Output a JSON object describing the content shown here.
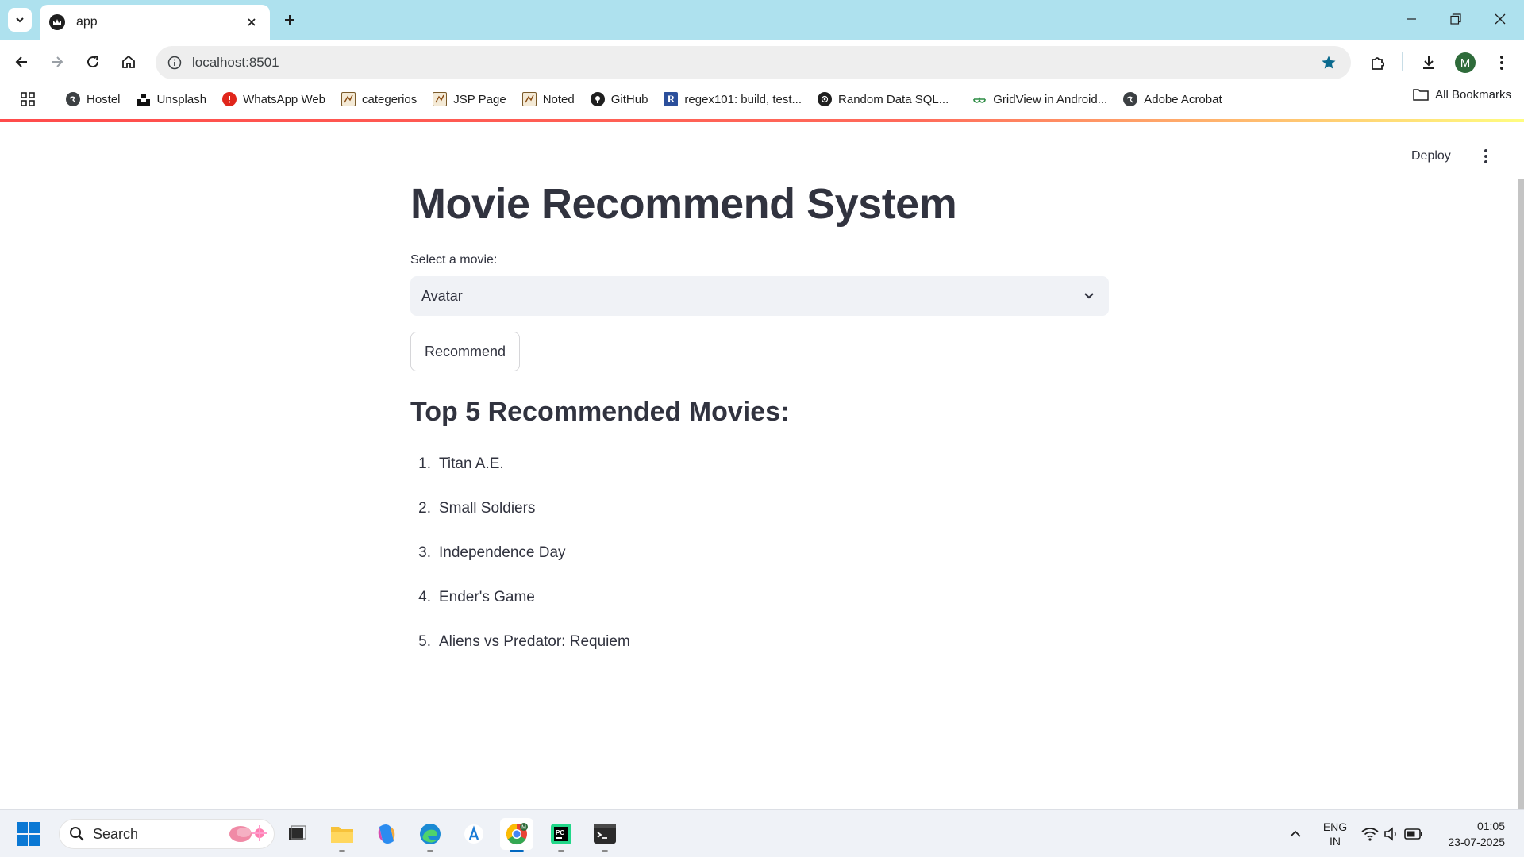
{
  "browser": {
    "tab_title": "app",
    "url": "localhost:8501",
    "profile_initial": "M"
  },
  "bookmarks": [
    {
      "label": "Hostel",
      "icon": "globe-icon"
    },
    {
      "label": "Unsplash",
      "icon": "unsplash-icon"
    },
    {
      "label": "WhatsApp Web",
      "icon": "alert-icon"
    },
    {
      "label": "categerios",
      "icon": "jsp-page-icon"
    },
    {
      "label": "JSP Page",
      "icon": "jsp-page-icon"
    },
    {
      "label": "Noted",
      "icon": "jsp-page-icon"
    },
    {
      "label": "GitHub",
      "icon": "github-icon"
    },
    {
      "label": "regex101: build, test...",
      "icon": "regex101-icon"
    },
    {
      "label": "Random Data SQL...",
      "icon": "openai-icon"
    },
    {
      "label": "GridView in Android...",
      "icon": "gfg-icon"
    },
    {
      "label": "Adobe Acrobat",
      "icon": "globe-icon"
    }
  ],
  "all_bookmarks_label": "All Bookmarks",
  "app": {
    "deploy_label": "Deploy",
    "title": "Movie Recommend System",
    "select_label": "Select a movie:",
    "selected_movie": "Avatar",
    "button_label": "Recommend",
    "results_heading": "Top 5 Recommended Movies:",
    "recommendations": [
      {
        "num": "1.",
        "title": "Titan A.E."
      },
      {
        "num": "2.",
        "title": "Small Soldiers"
      },
      {
        "num": "3.",
        "title": "Independence Day"
      },
      {
        "num": "4.",
        "title": "Ender's Game"
      },
      {
        "num": "5.",
        "title": "Aliens vs Predator: Requiem"
      }
    ]
  },
  "taskbar": {
    "search_placeholder": "Search",
    "lang_line1": "ENG",
    "lang_line2": "IN",
    "time": "01:05",
    "date": "23-07-2025"
  },
  "colors": {
    "streamlit_accent": "#ff4b4b",
    "tabstrip": "#aee1ee",
    "select_bg": "#f0f2f6",
    "text": "#31333f"
  }
}
